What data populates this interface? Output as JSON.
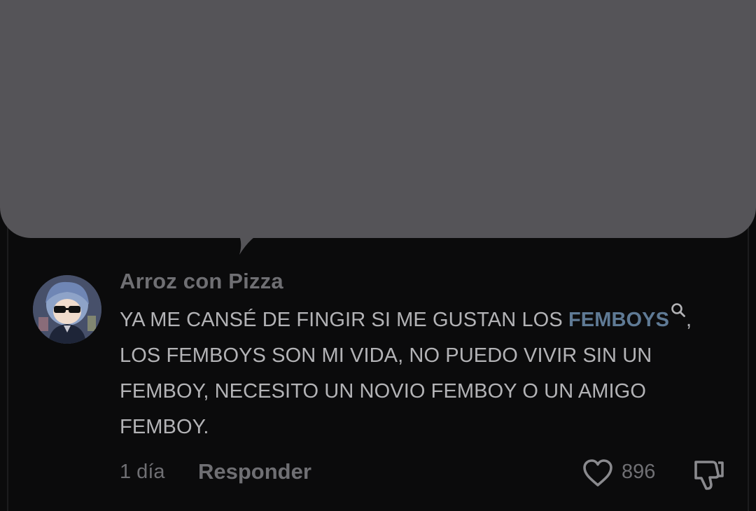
{
  "comment": {
    "author": "Arroz con Pizza",
    "text_before": "YA ME CANSÉ DE FINGIR SI ME GUSTAN LOS ",
    "hashtag": "FEMBOYS",
    "text_line1_end": ",",
    "text_rest": "LOS FEMBOYS SON MI VIDA, NO PUEDO VIVIR SIN UN FEMBOY, NECESITO UN NOVIO FEMBOY O UN AMIGO FEMBOY.",
    "age": "1 día",
    "reply_label": "Responder",
    "like_count": "896"
  },
  "icons": {
    "like": "heart-outline-icon",
    "dislike": "thumbs-down-outline-icon",
    "search": "search-icon"
  },
  "colors": {
    "background": "#0b0b0c",
    "bubble": "#555458",
    "text": "#b3b3b6",
    "muted": "#6f6f73",
    "hashtag": "#5f7a95"
  }
}
